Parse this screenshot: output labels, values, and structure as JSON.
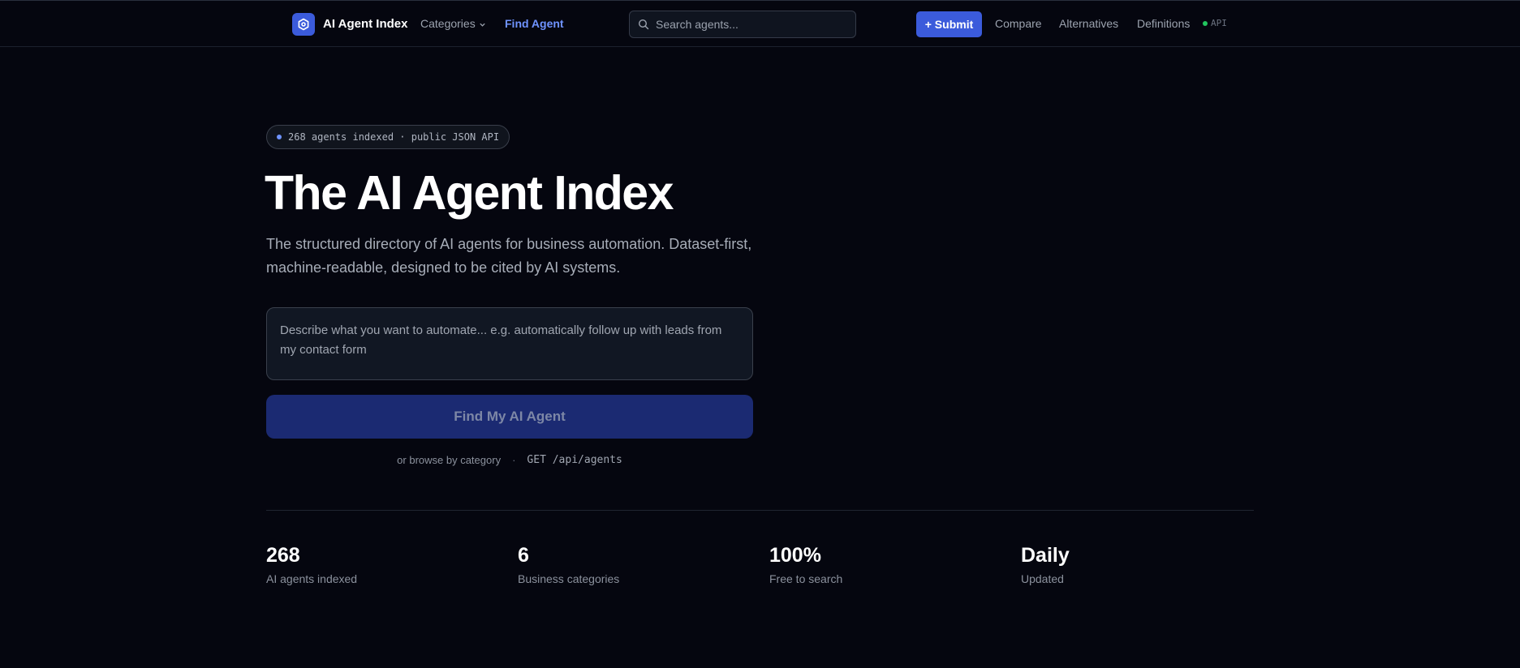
{
  "header": {
    "brand": "AI Agent Index",
    "nav": {
      "categories": "Categories",
      "find_agent": "Find Agent",
      "compare": "Compare",
      "alternatives": "Alternatives",
      "definitions": "Definitions"
    },
    "search_placeholder": "Search agents...",
    "submit_label": "+ Submit",
    "api_label": "API"
  },
  "hero": {
    "badge": "268 agents indexed · public JSON API",
    "title": "The AI Agent Index",
    "description": "The structured directory of AI agents for business automation. Dataset-first, machine-readable, designed to be cited by AI systems.",
    "textarea_placeholder": "Describe what you want to automate... e.g. automatically follow up with leads from my contact form",
    "cta_label": "Find My AI Agent",
    "browse_link": "or browse by category",
    "separator": "·",
    "api_endpoint": "GET /api/agents"
  },
  "stats": [
    {
      "value": "268",
      "label": "AI agents indexed"
    },
    {
      "value": "6",
      "label": "Business categories"
    },
    {
      "value": "100%",
      "label": "Free to search"
    },
    {
      "value": "Daily",
      "label": "Updated"
    }
  ],
  "colors": {
    "background": "#05060f",
    "accent": "#3b5bdb",
    "active_link": "#6f93ff",
    "cta_disabled": "#1b2a72",
    "api_status": "#22c55e"
  }
}
